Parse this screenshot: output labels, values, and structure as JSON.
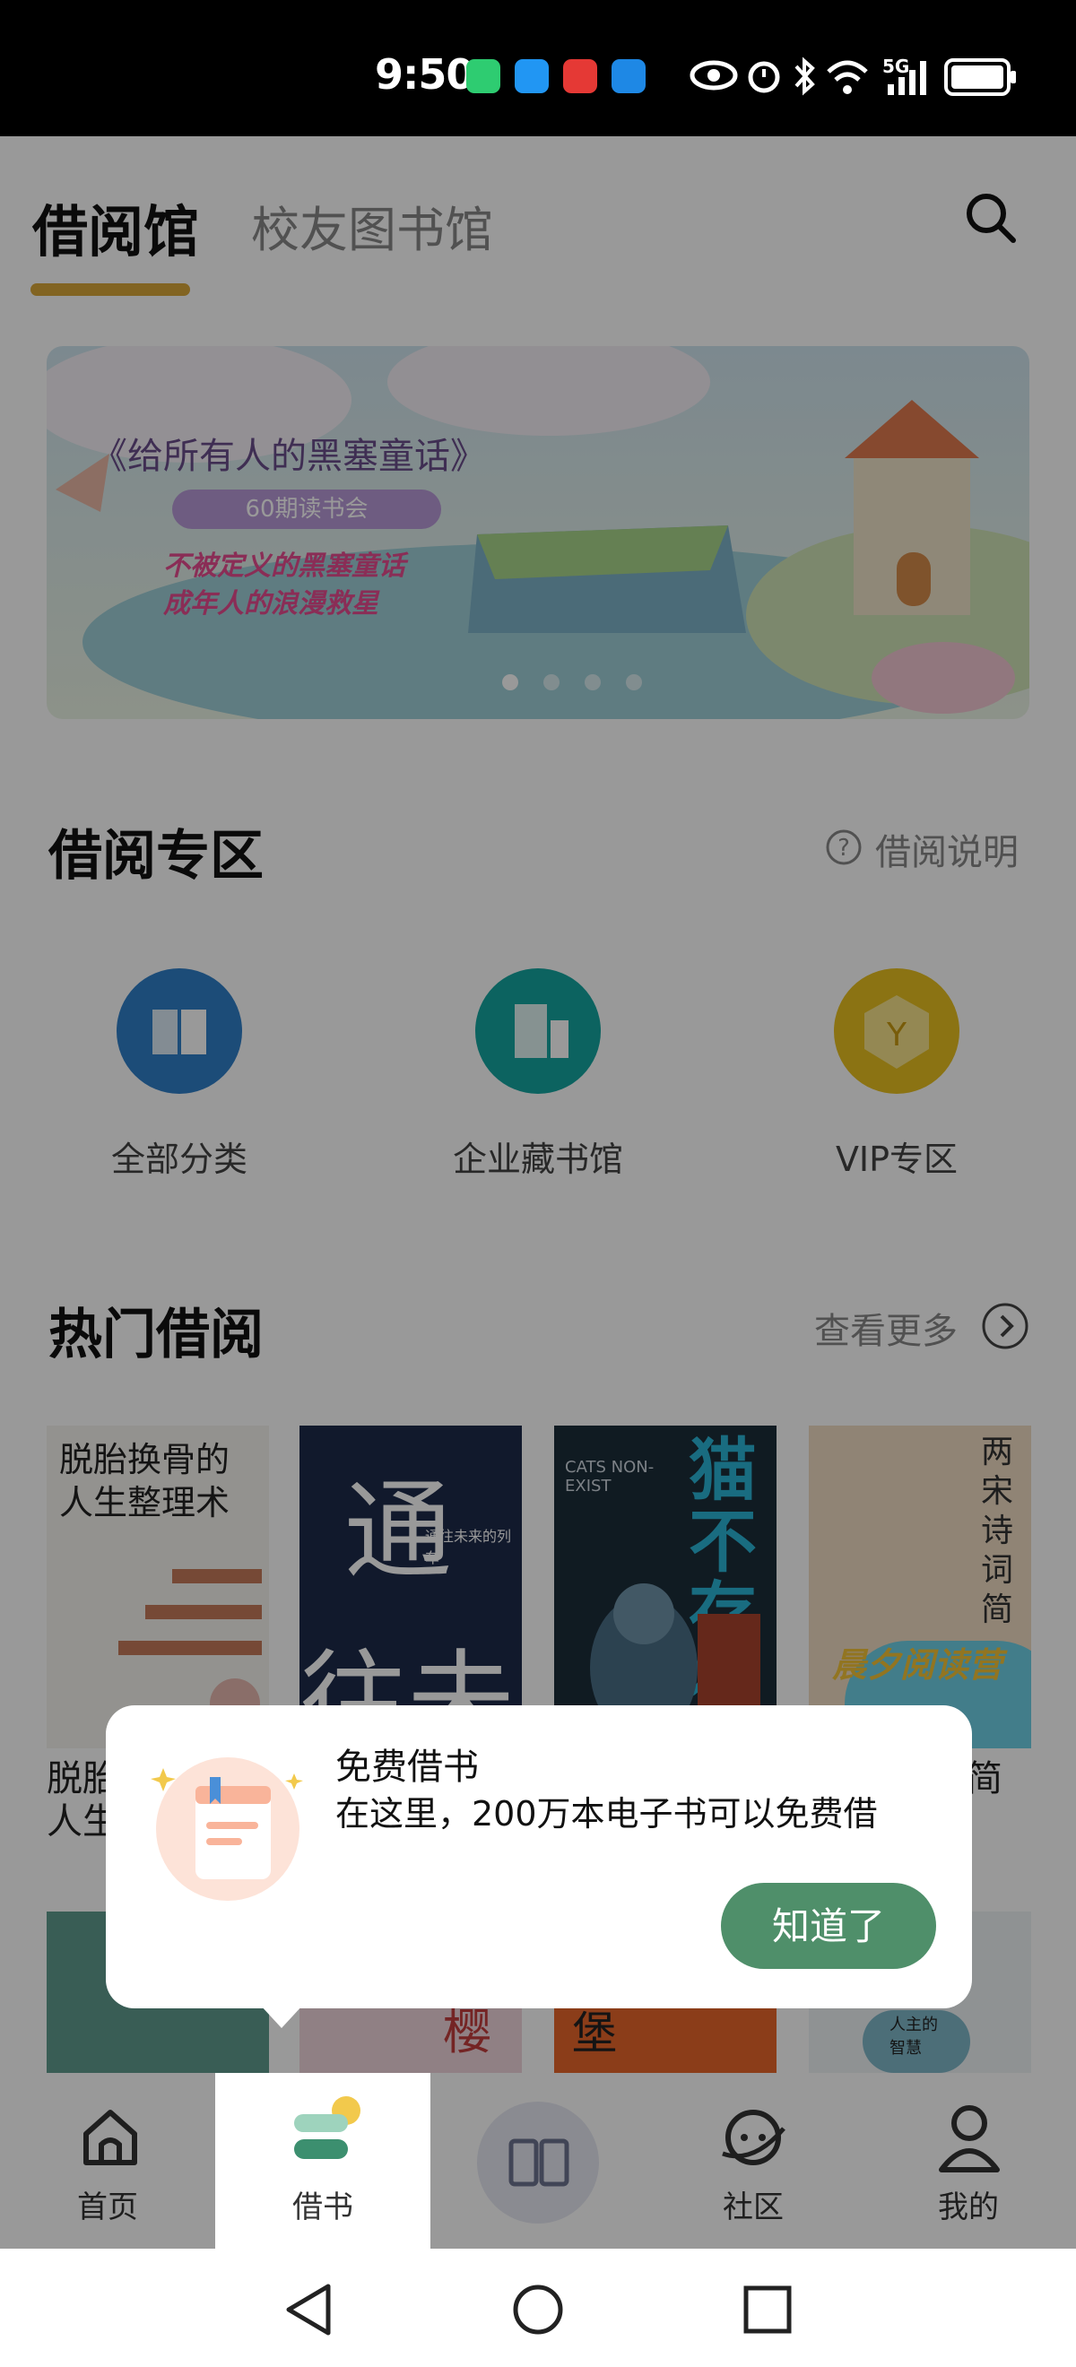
{
  "status_bar": {
    "time": "9:50",
    "network": "5G",
    "icons": [
      "battery-saver-icon",
      "message-icon",
      "reddit-icon",
      "app-icon",
      "eye-icon",
      "alarm-icon",
      "bluetooth-icon",
      "wifi-icon",
      "signal-icon",
      "battery-icon"
    ]
  },
  "header": {
    "tab_active": "借阅馆",
    "tab_inactive": "校友图书馆",
    "search_icon": "search-icon",
    "accent_color": "#d9a73a"
  },
  "banner": {
    "title": "《给所有人的黑塞童话》",
    "subtitle": "60期读书会",
    "line1": "不被定义的黑塞童话",
    "line2": "成年人的浪漫救星",
    "dots_total": 4,
    "dots_active": 1
  },
  "borrow_zone": {
    "title": "借阅专区",
    "help_label": "借阅说明",
    "help_icon": "question-circle-icon",
    "categories": [
      {
        "label": "全部分类",
        "icon": "book-open-icon",
        "color": "#2f7fc9"
      },
      {
        "label": "企业藏书馆",
        "icon": "building-icon",
        "color": "#15a6a0"
      },
      {
        "label": "VIP专区",
        "icon": "vip-y-icon",
        "color": "#e8c020"
      }
    ]
  },
  "hot_borrow": {
    "title": "热门借阅",
    "more_label": "查看更多",
    "more_icon": "chevron-right-circle-icon",
    "books": [
      {
        "cover_title": "脱胎换骨的人生整理术",
        "label_visible": "脱胎",
        "label_visible2": "人生"
      },
      {
        "cover_title": "通往未来的列车"
      },
      {
        "cover_title": "猫不存在",
        "cover_sub": "CATS NON-EXIST"
      },
      {
        "cover_title": "两宋诗词简",
        "badge": "晨夕阅读营",
        "label_visible": "简"
      }
    ],
    "row2": [
      {
        "cover_title": ""
      },
      {
        "cover_title": "樱"
      },
      {
        "cover_title": "堡"
      },
      {
        "cover_title": "人主的智慧"
      }
    ]
  },
  "tooltip": {
    "title": "免费借书",
    "body": "在这里，200万本电子书可以免费借",
    "button": "知道了",
    "button_color": "#4f8f6a"
  },
  "bottom_nav": {
    "items": [
      {
        "label": "首页",
        "icon": "home-icon"
      },
      {
        "label": "借书",
        "icon": "borrow-books-icon",
        "active": true
      },
      {
        "label": "",
        "icon": "reader-book-icon"
      },
      {
        "label": "社区",
        "icon": "community-planet-icon"
      },
      {
        "label": "我的",
        "icon": "profile-icon"
      }
    ]
  }
}
